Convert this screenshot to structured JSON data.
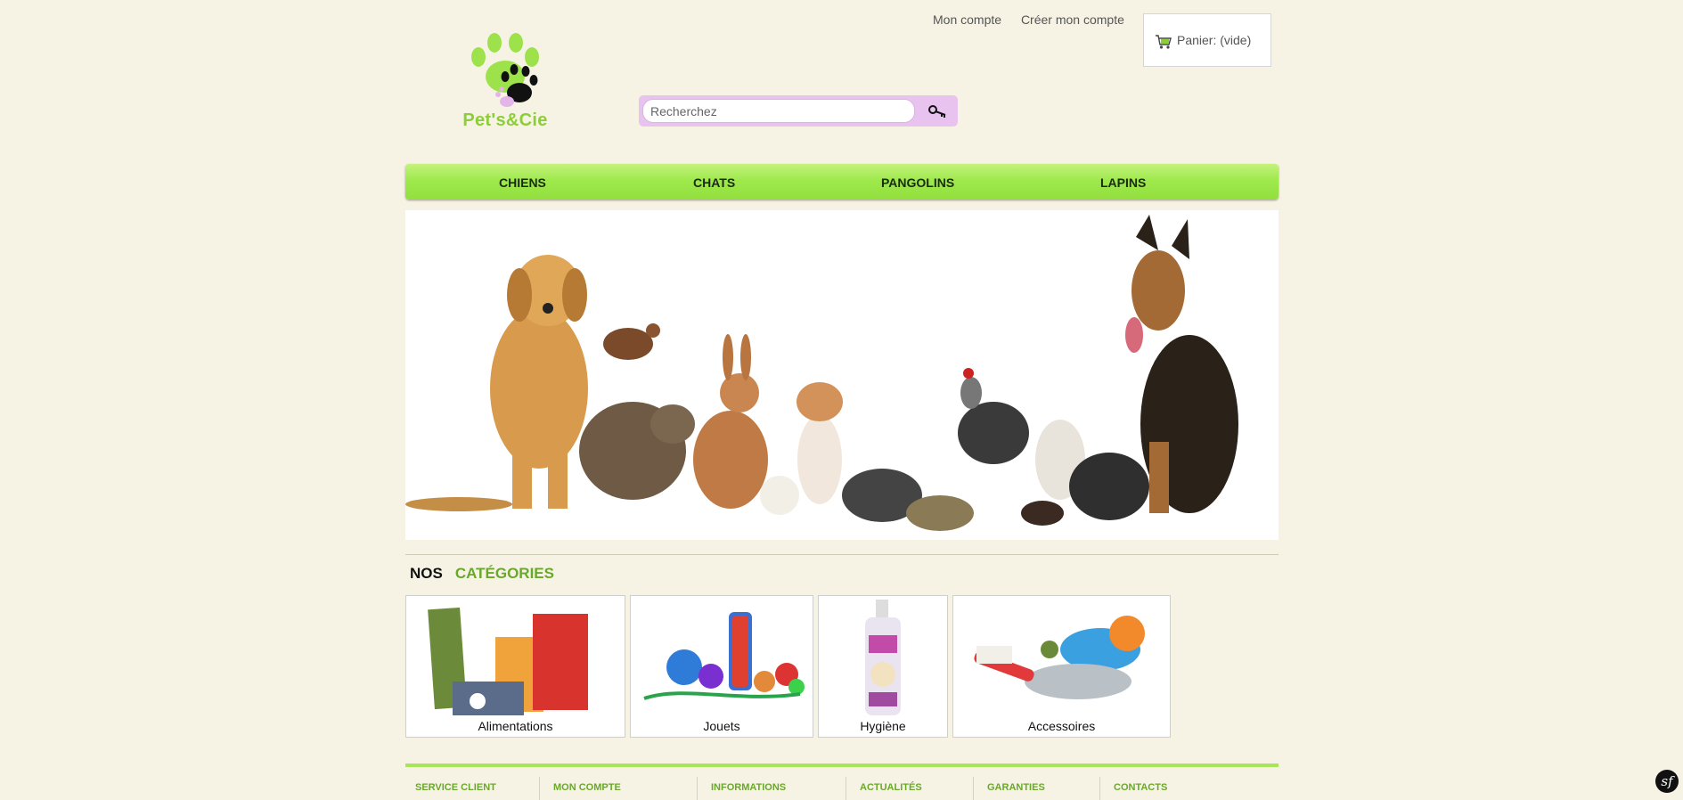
{
  "brand": {
    "name": "Pet's&Cie",
    "logo_color": "#8ccd3a"
  },
  "header": {
    "links": [
      "Mon compte",
      "Créer mon compte"
    ],
    "cart_label": "Panier: (vide)"
  },
  "search": {
    "placeholder": "Recherchez",
    "value": "",
    "button_icon": "search-key-icon"
  },
  "nav": {
    "items": [
      "CHIENS",
      "CHATS",
      "PANGOLINS",
      "LAPINS"
    ],
    "color": "#9fe94d"
  },
  "categories": {
    "title_part1": "NOS",
    "title_part2": "CATÉGORIES",
    "tiles": [
      "Alimentations",
      "Jouets",
      "Hygiène",
      "Accessoires"
    ]
  },
  "footer": {
    "items": [
      "SERVICE CLIENT",
      "MON COMPTE",
      "INFORMATIONS",
      "ACTUALITÉS",
      "GARANTIES",
      "CONTACTS"
    ]
  },
  "accent_color": "#6aa82b"
}
